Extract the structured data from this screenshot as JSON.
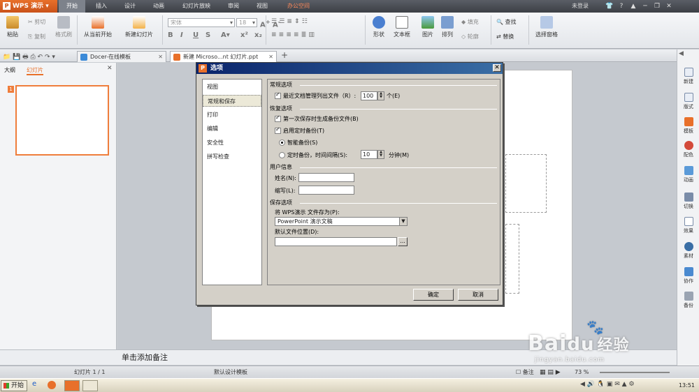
{
  "app": {
    "menu_label": "WPS 演示"
  },
  "menu_tabs": [
    "开始",
    "插入",
    "设计",
    "动画",
    "幻灯片放映",
    "审阅",
    "视图",
    "办公空间"
  ],
  "login_text": "未登录",
  "ribbon": {
    "paste": "粘贴",
    "cut": "剪切",
    "copy": "复制",
    "format_painter": "格式刷",
    "from_current": "从当前开始",
    "new_slide": "新建幻灯片",
    "font_name": "宋体",
    "font_size": "18",
    "shape": "形状",
    "textbox": "文本框",
    "picture": "图片",
    "arrange": "排列",
    "fill": "填充",
    "outline": "轮廓",
    "find": "查找",
    "replace": "替换",
    "select_pane": "选择窗格"
  },
  "doc_tabs": [
    {
      "label": "Docer-在线模板"
    },
    {
      "label": "新建 Microso...nt 幻灯片.ppt"
    }
  ],
  "left_panel": {
    "tab_outline": "大纲",
    "tab_slides": "幻灯片",
    "thumb_number": "1"
  },
  "notes_placeholder": "单击添加备注",
  "status": {
    "slide_info": "幻灯片 1 / 1",
    "template": "默认设计模板",
    "notes": "备注",
    "zoom": "73 %"
  },
  "right_panel": [
    "新建",
    "版式",
    "模板",
    "配色",
    "动画",
    "切换",
    "效果",
    "素材",
    "协作",
    "备份"
  ],
  "taskbar": {
    "start": "开始",
    "clock": "13:51"
  },
  "dialog": {
    "title": "选项",
    "nav": [
      "视图",
      "常规和保存",
      "打印",
      "编辑",
      "安全性",
      "拼写检查"
    ],
    "sections": {
      "general": "常规选项",
      "recover": "恢复选项",
      "user": "用户信息",
      "save": "保存选项"
    },
    "recent_files_label": "最近文档管理列出文件（R）:",
    "recent_files_value": "100",
    "recent_files_unit": "个(E)",
    "backup_first_save": "第一次保存时生成备份文件(B)",
    "timed_backup": "启用定时备份(T)",
    "smart_backup": "智能备份(S)",
    "interval_backup": "定时备份，时间间隔(S):",
    "interval_value": "10",
    "interval_unit": "分钟(M)",
    "name_label": "姓名(N):",
    "initials_label": "缩写(L):",
    "save_as_label": "将 WPS演示 文件存为(P):",
    "save_as_value": "PowerPoint 演示文稿",
    "default_location_label": "默认文件位置(D):",
    "browse": "...",
    "ok": "确定",
    "cancel": "取消"
  },
  "watermark": {
    "brand": "Bai",
    "suffix": "经验",
    "url": "jingyan.baidu.com"
  },
  "colors": {
    "accent": "#e8702a",
    "dialog_title": "#0a246a",
    "selection": "#ef7d3b"
  }
}
